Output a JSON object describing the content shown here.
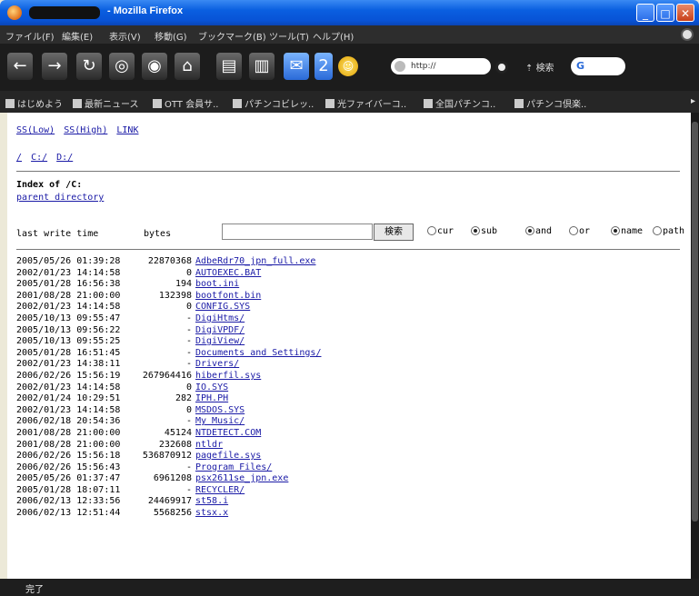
{
  "window": {
    "title": "- Mozilla Firefox"
  },
  "menu": [
    "ファイル(F)",
    "編集(E)",
    "表示(V)",
    "移動(G)",
    "ブックマーク(B)",
    "ツール(T)",
    "ヘルプ(H)"
  ],
  "toolbar": {
    "url": "http://",
    "search_label": "検索",
    "search_engine": "G"
  },
  "bookmarks": [
    "はじめよう",
    "最新ニュース",
    "OTT 会員サ..",
    "パチンコビレッ..",
    "光ファイバーコ..",
    "全国パチンコ..",
    "パチンコ倶楽.."
  ],
  "page": {
    "nav_links": [
      "SS(Low)",
      "SS(High)",
      "LINK"
    ],
    "drive_links": [
      "/",
      "C:/",
      "D:/"
    ],
    "index_title": "Index of /C:",
    "parent_link": "parent directory",
    "col_time": "last write time",
    "col_bytes": "bytes",
    "search_value": "",
    "search_button": "検索",
    "radio": [
      {
        "label": "cur",
        "checked": false
      },
      {
        "label": "sub",
        "checked": true
      },
      {
        "label": "and",
        "checked": true
      },
      {
        "label": "or",
        "checked": false
      },
      {
        "label": "name",
        "checked": true
      },
      {
        "label": "path",
        "checked": false
      }
    ],
    "files": [
      {
        "time": "2005/05/26 01:39:28",
        "size": "22870368",
        "name": "AdbeRdr70_jpn_full.exe"
      },
      {
        "time": "2002/01/23 14:14:58",
        "size": "0",
        "name": "AUTOEXEC.BAT"
      },
      {
        "time": "2005/01/28 16:56:38",
        "size": "194",
        "name": "boot.ini"
      },
      {
        "time": "2001/08/28 21:00:00",
        "size": "132398",
        "name": "bootfont.bin"
      },
      {
        "time": "2002/01/23 14:14:58",
        "size": "0",
        "name": "CONFIG.SYS"
      },
      {
        "time": "2005/10/13 09:55:47",
        "size": "-",
        "name": "DigiHtms/"
      },
      {
        "time": "2005/10/13 09:56:22",
        "size": "-",
        "name": "DigiVPDF/"
      },
      {
        "time": "2005/10/13 09:55:25",
        "size": "-",
        "name": "DigiView/"
      },
      {
        "time": "2005/01/28 16:51:45",
        "size": "-",
        "name": "Documents and Settings/"
      },
      {
        "time": "2002/01/23 14:38:11",
        "size": "-",
        "name": "Drivers/"
      },
      {
        "time": "2006/02/26 15:56:19",
        "size": "267964416",
        "name": "hiberfil.sys"
      },
      {
        "time": "2002/01/23 14:14:58",
        "size": "0",
        "name": "IO.SYS"
      },
      {
        "time": "2002/01/24 10:29:51",
        "size": "282",
        "name": "IPH.PH"
      },
      {
        "time": "2002/01/23 14:14:58",
        "size": "0",
        "name": "MSDOS.SYS"
      },
      {
        "time": "2006/02/18 20:54:36",
        "size": "-",
        "name": "My Music/"
      },
      {
        "time": "2001/08/28 21:00:00",
        "size": "45124",
        "name": "NTDETECT.COM"
      },
      {
        "time": "2001/08/28 21:00:00",
        "size": "232608",
        "name": "ntldr"
      },
      {
        "time": "2006/02/26 15:56:18",
        "size": "536870912",
        "name": "pagefile.sys"
      },
      {
        "time": "2006/02/26 15:56:43",
        "size": "-",
        "name": "Program Files/"
      },
      {
        "time": "2005/05/26 01:37:47",
        "size": "6961208",
        "name": "psx2611se_jpn.exe"
      },
      {
        "time": "2005/01/28 18:07:11",
        "size": "-",
        "name": "RECYCLER/"
      },
      {
        "time": "2006/02/13 12:33:56",
        "size": "24469917",
        "name": "st58.i"
      },
      {
        "time": "2006/02/13 12:51:44",
        "size": "5568256",
        "name": "stsx.x"
      }
    ]
  },
  "status": {
    "text": "完了"
  }
}
